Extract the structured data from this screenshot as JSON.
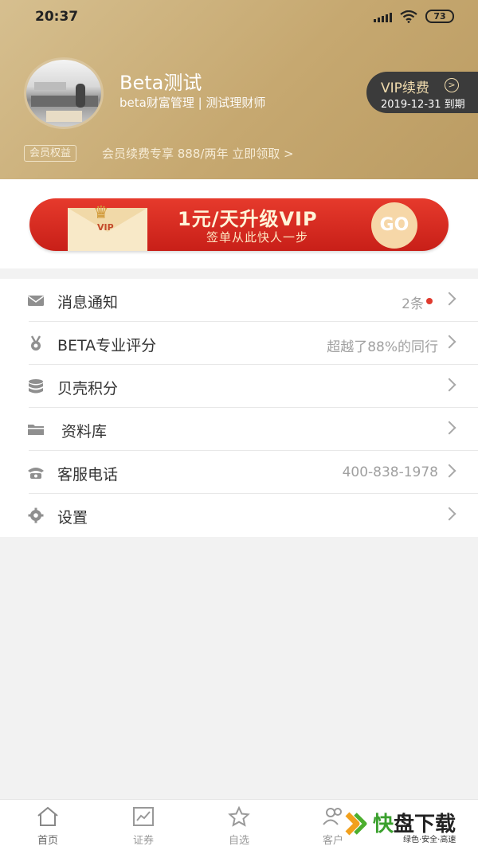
{
  "status_bar": {
    "time": "20:37",
    "battery": "73"
  },
  "profile": {
    "name": "Beta测试",
    "subtitle": "beta财富管理 | 测试理财师",
    "vip_label": "VIP续费",
    "vip_expire": "2019-12-31 到期",
    "perk_tag": "会员权益",
    "perk_text": "会员续费专享 888/两年 立即领取 >"
  },
  "banner": {
    "envelope_text": "VIP",
    "title": "1元/天升级VIP",
    "subtitle": "签单从此快人一步",
    "go_label": "GO"
  },
  "menu": {
    "items": [
      {
        "label": "消息通知",
        "value": "2条",
        "icon": "mail-icon",
        "has_dot": true
      },
      {
        "label": "BETA专业评分",
        "value": "超越了88%的同行",
        "icon": "medal-icon"
      },
      {
        "label": "贝壳积分",
        "value": "",
        "icon": "coins-icon"
      },
      {
        "label": "资料库",
        "value": "",
        "icon": "folder-icon"
      },
      {
        "label": "客服电话",
        "value": "400-838-1978",
        "icon": "phone-icon"
      },
      {
        "label": "设置",
        "value": "",
        "icon": "gear-icon"
      }
    ]
  },
  "tabbar": {
    "tabs": [
      {
        "label": "首页",
        "icon": "home-icon"
      },
      {
        "label": "证券",
        "icon": "chart-icon"
      },
      {
        "label": "自选",
        "icon": "star-icon"
      },
      {
        "label": "客户",
        "icon": "users-icon"
      }
    ]
  },
  "watermark": {
    "title_green": "快",
    "title_dark": "盘下载",
    "slogan": "绿色·安全·高速"
  },
  "colors": {
    "header_gold": "#c6a870",
    "banner_red": "#d82a20",
    "accent_red": "#e03a2e"
  }
}
